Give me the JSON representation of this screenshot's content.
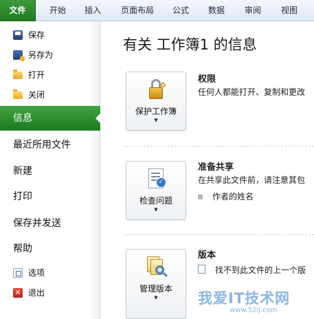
{
  "ribbon": {
    "tabs": [
      "文件",
      "开始",
      "插入",
      "页面布局",
      "公式",
      "数据",
      "审阅",
      "视图"
    ]
  },
  "nav": {
    "small_top": [
      {
        "label": "保存",
        "icon": "save-icon"
      },
      {
        "label": "另存为",
        "icon": "save-as-icon"
      },
      {
        "label": "打开",
        "icon": "open-folder-icon"
      },
      {
        "label": "关闭",
        "icon": "close-folder-icon"
      }
    ],
    "big": [
      {
        "label": "信息",
        "active": true
      },
      {
        "label": "最近所用文件"
      },
      {
        "label": "新建"
      },
      {
        "label": "打印"
      },
      {
        "label": "保存并发送"
      },
      {
        "label": "帮助"
      }
    ],
    "small_bottom": [
      {
        "label": "选项",
        "icon": "options-icon"
      },
      {
        "label": "退出",
        "icon": "exit-icon"
      }
    ],
    "active_color": "#2e8f30"
  },
  "main": {
    "title": "有关 工作簿1 的信息",
    "sections": [
      {
        "button_label": "保护工作簿",
        "button_icon": "lock-key-icon",
        "heading": "权限",
        "description": "任何人都能打开、复制和更改",
        "bullet": ""
      },
      {
        "button_label": "检查问题",
        "button_icon": "document-check-icon",
        "heading": "准备共享",
        "description": "在共享此文件前，请注意其包",
        "bullet": "作者的姓名"
      },
      {
        "button_label": "管理版本",
        "button_icon": "versions-magnifier-icon",
        "heading": "版本",
        "description": "",
        "bullet": "找不到此文件的上一个版"
      }
    ]
  },
  "watermark": {
    "text": "我爱IT技术网",
    "url": "www.52ij.com"
  }
}
